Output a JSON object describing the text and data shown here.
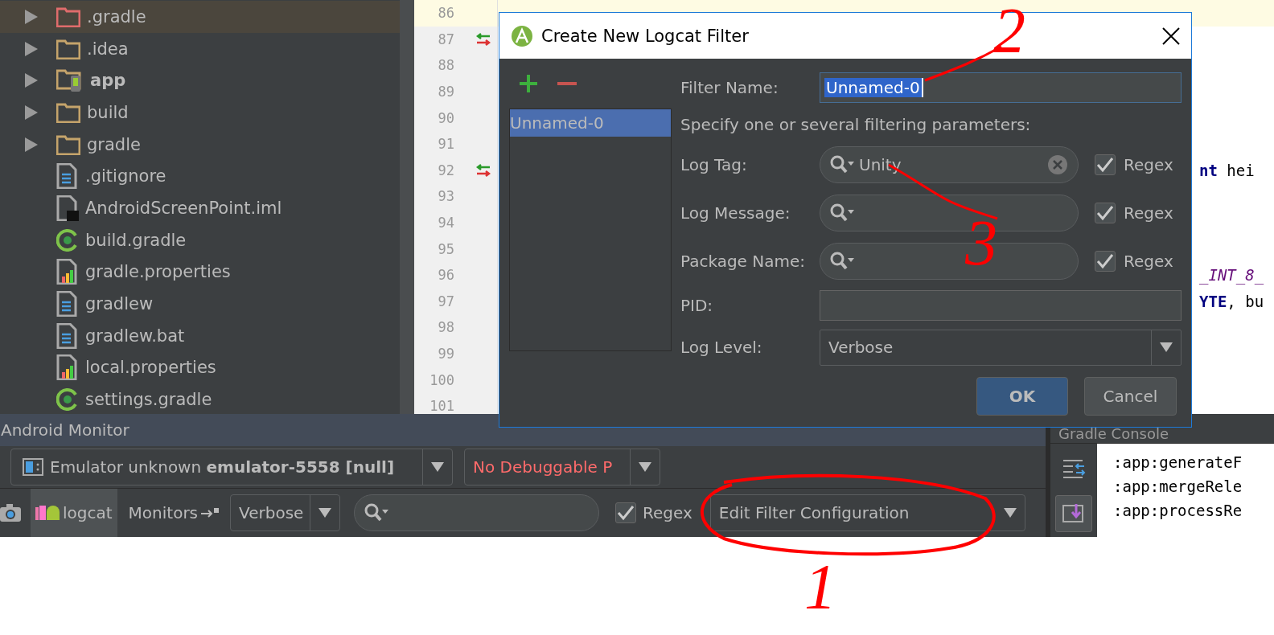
{
  "project_tree": {
    "items": [
      {
        "label": ".gradle",
        "kind": "excluded-folder",
        "expandable": true,
        "selected": true
      },
      {
        "label": ".idea",
        "kind": "folder",
        "expandable": true,
        "selected": false
      },
      {
        "label": "app",
        "kind": "module",
        "expandable": true,
        "selected": false
      },
      {
        "label": "build",
        "kind": "folder",
        "expandable": true,
        "selected": false
      },
      {
        "label": "gradle",
        "kind": "folder",
        "expandable": true,
        "selected": false
      },
      {
        "label": ".gitignore",
        "kind": "text-file",
        "expandable": false,
        "selected": false
      },
      {
        "label": "AndroidScreenPoint.iml",
        "kind": "module-file",
        "expandable": false,
        "selected": false
      },
      {
        "label": "build.gradle",
        "kind": "gradle-file",
        "expandable": false,
        "selected": false
      },
      {
        "label": "gradle.properties",
        "kind": "properties-file",
        "expandable": false,
        "selected": false
      },
      {
        "label": "gradlew",
        "kind": "text-file",
        "expandable": false,
        "selected": false
      },
      {
        "label": "gradlew.bat",
        "kind": "text-file",
        "expandable": false,
        "selected": false
      },
      {
        "label": "local.properties",
        "kind": "properties-file",
        "expandable": false,
        "selected": false
      },
      {
        "label": "settings.gradle",
        "kind": "gradle-file",
        "expandable": false,
        "selected": false
      }
    ]
  },
  "editor": {
    "lines": [
      {
        "number": "86",
        "current": true,
        "changed": false
      },
      {
        "number": "87",
        "current": false,
        "changed": true
      },
      {
        "number": "88",
        "current": false,
        "changed": false
      },
      {
        "number": "89",
        "current": false,
        "changed": false
      },
      {
        "number": "90",
        "current": false,
        "changed": false
      },
      {
        "number": "91",
        "current": false,
        "changed": false
      },
      {
        "number": "92",
        "current": false,
        "changed": true,
        "code": "**nt** hei"
      },
      {
        "number": "93",
        "current": false,
        "changed": false
      },
      {
        "number": "94",
        "current": false,
        "changed": false
      },
      {
        "number": "95",
        "current": false,
        "changed": false
      },
      {
        "number": "96",
        "current": false,
        "changed": false,
        "code": "*_INT_8_*"
      },
      {
        "number": "97",
        "current": false,
        "changed": false,
        "code": "**YTE**, bu"
      },
      {
        "number": "98",
        "current": false,
        "changed": false
      },
      {
        "number": "99",
        "current": false,
        "changed": false
      },
      {
        "number": "100",
        "current": false,
        "changed": false
      },
      {
        "number": "101",
        "current": false,
        "changed": false
      }
    ]
  },
  "dialog": {
    "title": "Create New Logcat Filter",
    "filters": [
      {
        "label": "Unnamed-0",
        "selected": true
      }
    ],
    "filter_name": {
      "label": "Filter Name:",
      "value": "Unnamed-0"
    },
    "hint": "Specify one or several filtering parameters:",
    "parameters": [
      {
        "label": "Log Tag:",
        "value": "Unity",
        "regex": true,
        "regex_label": "Regex"
      },
      {
        "label": "Log Message:",
        "regex": true,
        "regex_label": "Regex"
      },
      {
        "label": "Package Name:",
        "regex": true,
        "regex_label": "Regex"
      }
    ],
    "pid": {
      "label": "PID:"
    },
    "log_level": {
      "label": "Log Level:",
      "value": "Verbose"
    },
    "buttons": [
      {
        "label": "OK",
        "default": true
      },
      {
        "label": "Cancel",
        "default": false
      }
    ]
  },
  "android_monitor": {
    "title": "Android Monitor",
    "device": "Emulator unknown **emulator-5558 [null]**",
    "process": "No Debuggable P",
    "tabs": [
      {
        "label": "logcat",
        "selected": true
      },
      {
        "label": "Monitors",
        "selected": false
      }
    ],
    "log_level": "Verbose",
    "regex": {
      "label": "Regex",
      "checked": true
    },
    "filter": "Edit Filter Configuration"
  },
  "gradle_console": {
    "title": "Gradle Console",
    "lines": [
      ":app:generateF",
      ":app:mergeRele",
      ":app:processRe"
    ]
  },
  "annotations": [
    {
      "label": "2"
    },
    {
      "label": "3"
    },
    {
      "label": "1"
    }
  ]
}
